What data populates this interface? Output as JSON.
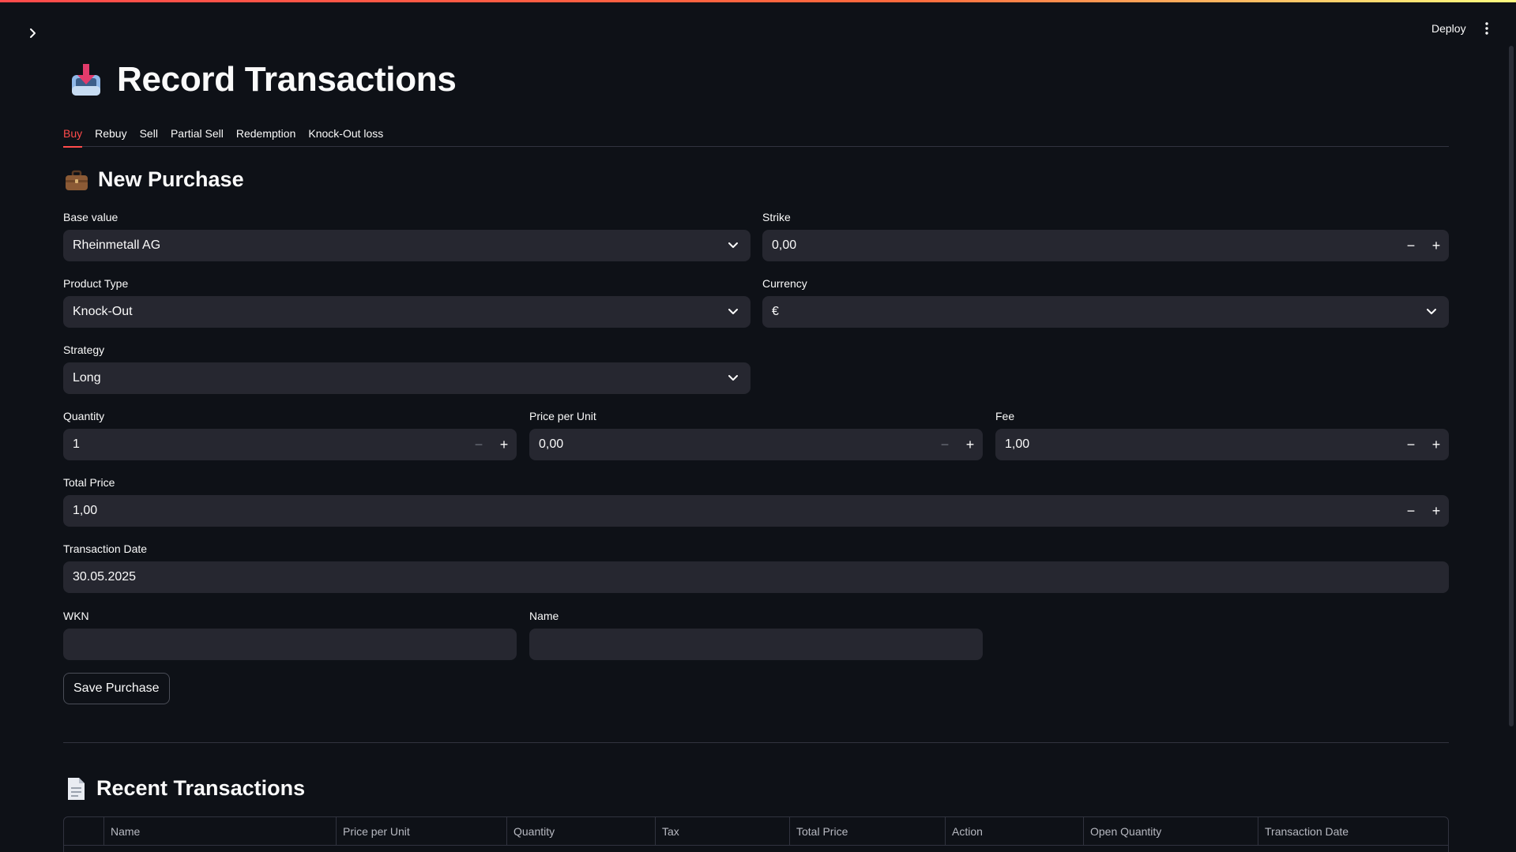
{
  "header": {
    "deploy_label": "Deploy"
  },
  "page": {
    "title": "Record Transactions",
    "title_icon": "inbox-tray-icon"
  },
  "tabs": [
    "Buy",
    "Rebuy",
    "Sell",
    "Partial Sell",
    "Redemption",
    "Knock-Out loss"
  ],
  "active_tab": "Buy",
  "purchase": {
    "heading": "New Purchase",
    "heading_icon": "briefcase-icon",
    "base_value": {
      "label": "Base value",
      "value": "Rheinmetall AG"
    },
    "strike": {
      "label": "Strike",
      "value": "0,00"
    },
    "product_type": {
      "label": "Product Type",
      "value": "Knock-Out"
    },
    "currency": {
      "label": "Currency",
      "value": "€"
    },
    "strategy": {
      "label": "Strategy",
      "value": "Long"
    },
    "quantity": {
      "label": "Quantity",
      "value": "1"
    },
    "price_per_unit": {
      "label": "Price per Unit",
      "value": "0,00"
    },
    "fee": {
      "label": "Fee",
      "value": "1,00"
    },
    "total_price": {
      "label": "Total Price",
      "value": "1,00"
    },
    "transaction_date": {
      "label": "Transaction Date",
      "value": "30.05.2025"
    },
    "wkn": {
      "label": "WKN",
      "value": ""
    },
    "name": {
      "label": "Name",
      "value": ""
    },
    "save_label": "Save Purchase"
  },
  "recent": {
    "heading": "Recent Transactions",
    "heading_icon": "page-icon",
    "columns": [
      "",
      "Name",
      "Price per Unit",
      "Quantity",
      "Tax",
      "Total Price",
      "Action",
      "Open Quantity",
      "Transaction Date"
    ]
  },
  "colors": {
    "accent": "#ff4b4b",
    "background": "#0e1117",
    "input_bg": "#262730"
  }
}
